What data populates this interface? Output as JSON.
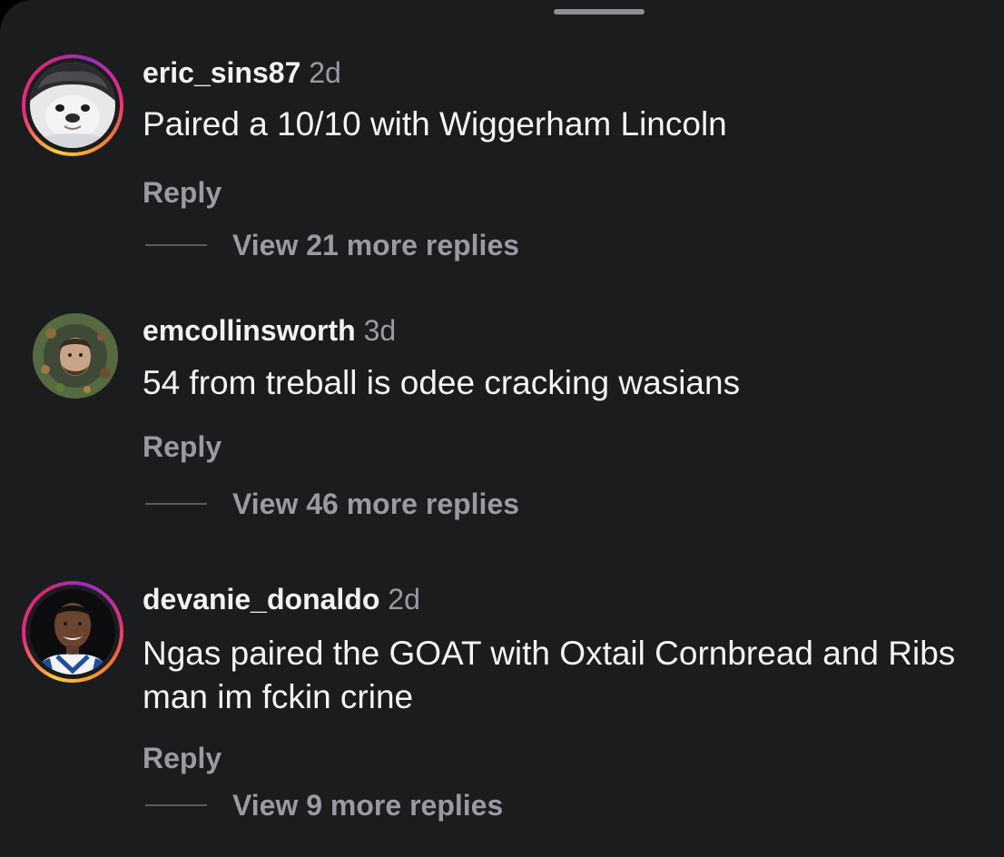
{
  "comments": [
    {
      "username": "eric_sins87",
      "time": "2d",
      "text": "Paired a 10/10 with Wiggerham Lincoln",
      "reply_label": "Reply",
      "view_replies_label": "View 21 more replies",
      "avatar_icon": "bulldog-photo",
      "has_story_ring": true
    },
    {
      "username": "emcollinsworth",
      "time": "3d",
      "text": "54 from treball is odee cracking wasians",
      "reply_label": "Reply",
      "view_replies_label": "View 46 more replies",
      "avatar_icon": "wreath-portrait-photo",
      "has_story_ring": false
    },
    {
      "username": "devanie_donaldo",
      "time": "2d",
      "text": "Ngas paired the GOAT with Oxtail Cornbread and Ribs man im fckin crine",
      "reply_label": "Reply",
      "view_replies_label": "View 9 more replies",
      "avatar_icon": "player-portrait-photo",
      "has_story_ring": true
    }
  ],
  "colors": {
    "background": "#1b1c1e",
    "primary_text": "#f2f2f2",
    "secondary_text": "#9a9aa0",
    "story_ring_start": "#f9ce34",
    "story_ring_mid": "#ee2a7b",
    "story_ring_end": "#962fbf"
  }
}
